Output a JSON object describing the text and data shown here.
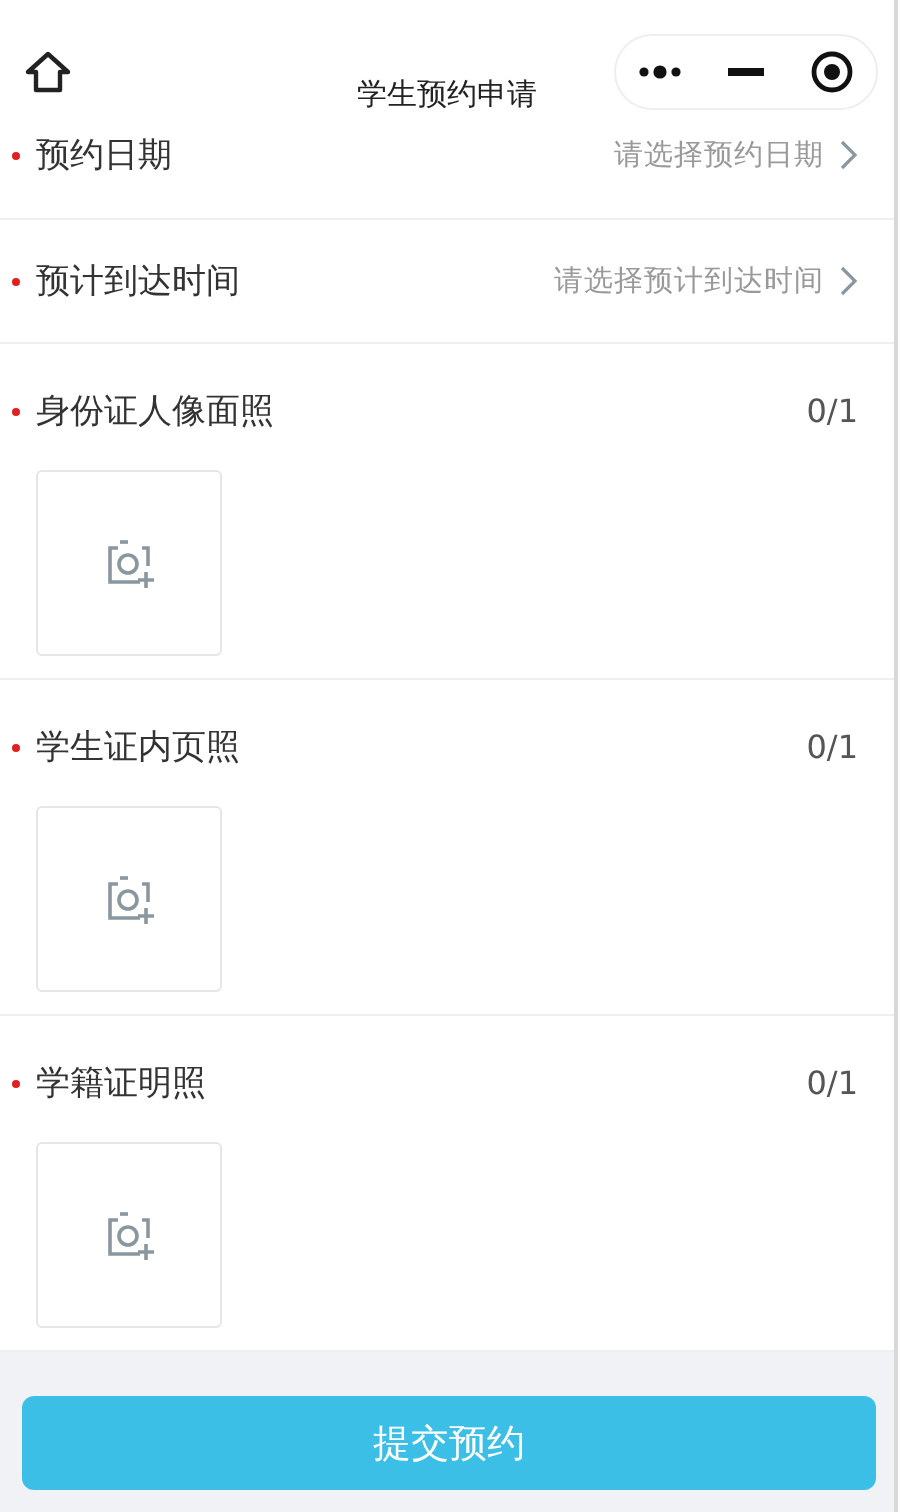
{
  "header": {
    "title": "学生预约申请"
  },
  "pickers": [
    {
      "label": "预约日期",
      "required": true,
      "placeholder": "请选择预约日期"
    },
    {
      "label": "预计到达时间",
      "required": true,
      "placeholder": "请选择预计到达时间"
    }
  ],
  "uploads": [
    {
      "label": "身份证人像面照",
      "required": true,
      "count": "0/1"
    },
    {
      "label": "学生证内页照",
      "required": true,
      "count": "0/1"
    },
    {
      "label": "学籍证明照",
      "required": true,
      "count": "0/1"
    }
  ],
  "submit_button": "提交预约"
}
